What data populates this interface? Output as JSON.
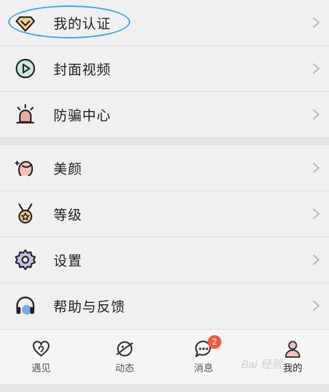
{
  "menu_group_1": [
    {
      "label": "我的认证",
      "icon": "diamond-badge-icon"
    },
    {
      "label": "封面视频",
      "icon": "play-circle-icon"
    },
    {
      "label": "防骗中心",
      "icon": "alarm-light-icon"
    }
  ],
  "menu_group_2": [
    {
      "label": "美颜",
      "icon": "beauty-face-icon"
    },
    {
      "label": "等级",
      "icon": "medal-icon"
    },
    {
      "label": "设置",
      "icon": "gear-icon"
    },
    {
      "label": "帮助与反馈",
      "icon": "headset-icon"
    }
  ],
  "tabbar": {
    "tabs": [
      {
        "label": "遇见",
        "icon": "hearts-icon"
      },
      {
        "label": "动态",
        "icon": "planet-icon"
      },
      {
        "label": "消息",
        "icon": "chat-bubble-icon",
        "badge": "2"
      },
      {
        "label": "我的",
        "icon": "person-icon",
        "active": true
      }
    ]
  },
  "watermark": "Bai 经验",
  "colors": {
    "highlight_ring": "#39a3e6",
    "badge": "#f05a3c",
    "icon_accent_pink": "#f2b6b6",
    "icon_accent_blue": "#7da6e8",
    "icon_accent_orange": "#e9a56b"
  }
}
